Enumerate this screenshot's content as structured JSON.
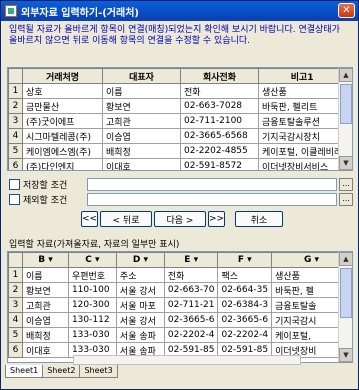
{
  "window": {
    "title": "외부자료 입력하기-(거래처)",
    "close_glyph": "✕"
  },
  "instructions": "입력될 자료가 올바르게 항목이 연결(매칭)되었는지 확인해 보시기 바랍니다. 연결상태가 올바르지 않으면 뒤로 이동해 항목의 연결을 수정할 수 있습니다.",
  "mapping_grid": {
    "headers": [
      "거래처명",
      "대표자",
      "회사전화",
      "비고1"
    ],
    "rows": [
      {
        "num": "1",
        "cells": [
          "상호",
          "이름",
          "전화",
          "생산품"
        ]
      },
      {
        "num": "2",
        "cells": [
          "금만물산",
          "황보연",
          "02-663-7028",
          "바둑판, 펠리트"
        ]
      },
      {
        "num": "3",
        "cells": [
          "(주)굿이에프",
          "고희관",
          "02-711-2100",
          "금융토탈솔루션"
        ]
      },
      {
        "num": "4",
        "cells": [
          "시그마텔레콤(주)",
          "이승엽",
          "02-3665-6568",
          "기지국감시장치"
        ]
      },
      {
        "num": "5",
        "cells": [
          "케이엠에스엠(주)",
          "배희정",
          "02-2202-4855",
          "케이포털, 이클레비레"
        ]
      },
      {
        "num": "6",
        "cells": [
          "(주)다인엔지",
          "이대호",
          "02-591-8572",
          "이더넷장비서비스"
        ]
      }
    ]
  },
  "conditions": {
    "save_label": "저장할 조건",
    "exclude_label": "제외할 조건",
    "save_value": "",
    "exclude_value": "",
    "browse_glyph": "..."
  },
  "navigation": {
    "first": "<<",
    "back": "< 뒤로",
    "next": "다음 >",
    "last": ">>",
    "cancel": "취소"
  },
  "source_section_label": "입력할 자료(가져올자료, 자료의 일부만 표시)",
  "source_grid": {
    "headers": [
      "B",
      "C",
      "D",
      "E",
      "F",
      "G"
    ],
    "rows": [
      {
        "num": "1",
        "cells": [
          "이름",
          "우편번호",
          "주소",
          "전화",
          "팩스",
          "생산품"
        ]
      },
      {
        "num": "2",
        "cells": [
          "황보연",
          "110-100",
          "서울 강서",
          "02-663-70",
          "02-664-35",
          "바둑판, 펠"
        ]
      },
      {
        "num": "3",
        "cells": [
          "고희관",
          "120-300",
          "서울 마포",
          "02-711-21",
          "02-6384-3",
          "금융토탈솔"
        ]
      },
      {
        "num": "4",
        "cells": [
          "이승엽",
          "130-112",
          "서울 강서",
          "02-3665-6",
          "02-3665-6",
          "기지국감시"
        ]
      },
      {
        "num": "5",
        "cells": [
          "배희정",
          "133-030",
          "서울 송파",
          "02-2202-4",
          "02-2202-4",
          "케이포털,"
        ]
      },
      {
        "num": "6",
        "cells": [
          "이대호",
          "133-030",
          "서울 송파",
          "02-591-85",
          "02-591-85",
          "이더넷장비"
        ]
      }
    ]
  },
  "sheet_tabs": [
    "Sheet1",
    "Sheet2",
    "Sheet3"
  ],
  "colors": {
    "title_bar": "#0a4fd0",
    "instruction_text": "#0000b0",
    "window_bg": "#ece9d8"
  }
}
